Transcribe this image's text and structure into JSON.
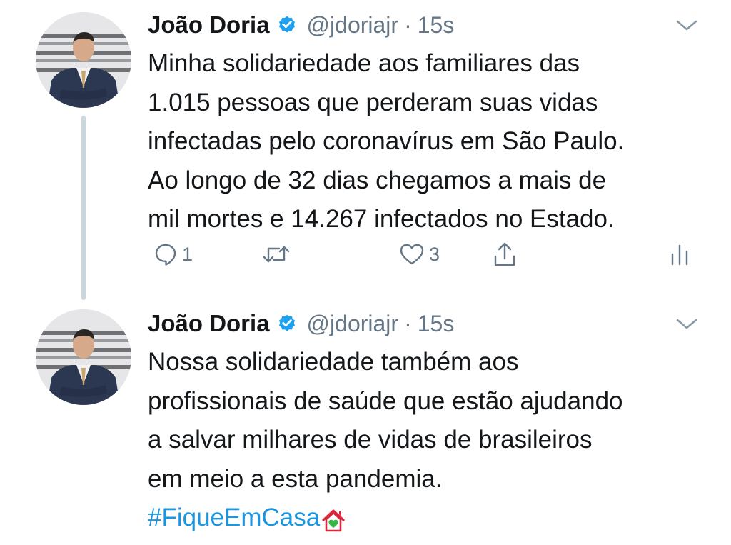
{
  "thread": {
    "tweets": [
      {
        "author_name": "João Doria",
        "handle": "@jdoriajr",
        "separator": "·",
        "time": "15s",
        "lines": [
          "Minha solidariedade aos familiares das",
          "1.015 pessoas que perderam suas vidas",
          "infectadas pelo coronavírus em São Paulo.",
          "Ao longo de 32 dias chegamos a mais de",
          "mil mortes e 14.267 infectados no Estado."
        ],
        "actions": {
          "reply_count": "1",
          "retweet_count": "",
          "like_count": "3"
        }
      },
      {
        "author_name": "João Doria",
        "handle": "@jdoriajr",
        "separator": "·",
        "time": "15s",
        "lines": [
          "Nossa solidariedade também aos",
          "profissionais de saúde que estão ajudando",
          "a salvar milhares de vidas de brasileiros",
          "em meio a esta pandemia."
        ],
        "hashtag": "#FiqueEmCasa"
      }
    ]
  },
  "icons": {
    "verified": "verified-badge-icon",
    "caret": "chevron-down-icon",
    "reply": "reply-bubble-icon",
    "retweet": "retweet-icon",
    "like": "heart-icon",
    "share": "share-icon",
    "analytics": "analytics-bars-icon",
    "emoji": "house-with-heart-emoji"
  },
  "colors": {
    "text_primary": "#14171a",
    "text_secondary": "#657786",
    "link": "#1b95e0",
    "verified_badge": "#1da1f2",
    "thread_line": "#ccd6dd"
  }
}
